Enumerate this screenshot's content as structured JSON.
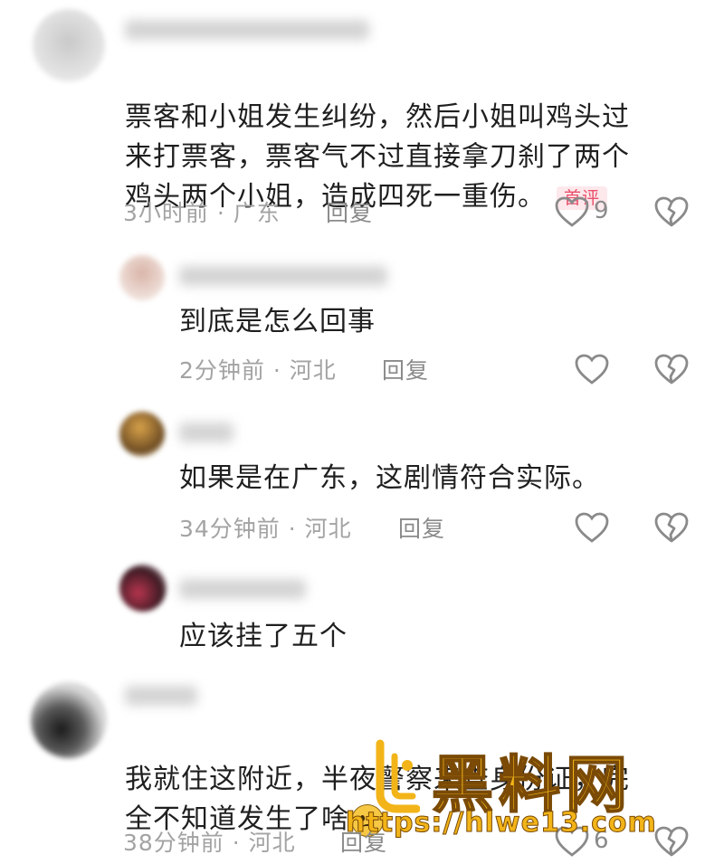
{
  "colors": {
    "badge_text": "#e8506a",
    "badge_bg": "#fde8ec",
    "meta_text": "#a3a3a3",
    "watermark": "#f2b418"
  },
  "comments": [
    {
      "text": "票客和小姐发生纠纷，然后小姐叫鸡头过\n来打票客，票客气不过直接拿刀刹了两个\n鸡头两个小姐，造成四死一重伤。",
      "badge": "首评",
      "time": "3小时前",
      "sep": "·",
      "location": "广东",
      "reply_label": "回复",
      "like_count": "9",
      "like_icon": "heart-outline-icon",
      "dislike_icon": "broken-heart-icon"
    },
    {
      "text": "到底是怎么回事",
      "time": "2分钟前",
      "sep": "·",
      "location": "河北",
      "reply_label": "回复",
      "like_icon": "heart-outline-icon",
      "dislike_icon": "broken-heart-icon"
    },
    {
      "text": "如果是在广东，这剧情符合实际。",
      "time": "34分钟前",
      "sep": "·",
      "location": "河北",
      "reply_label": "回复",
      "like_icon": "heart-outline-icon",
      "dislike_icon": "broken-heart-icon"
    },
    {
      "text": "应该挂了五个"
    },
    {
      "text": "我就住这附近，半夜警察来查身份证，完\n全不知道发生了啥",
      "emoji": "sad-face-emoji",
      "time": "38分钟前",
      "sep": "·",
      "location": "河北",
      "reply_label": "回复",
      "like_count": "6",
      "like_icon": "heart-outline-icon",
      "dislike_icon": "broken-heart-icon"
    }
  ],
  "watermark": {
    "title": "黑料网",
    "url": "https://hlwe13.com"
  }
}
